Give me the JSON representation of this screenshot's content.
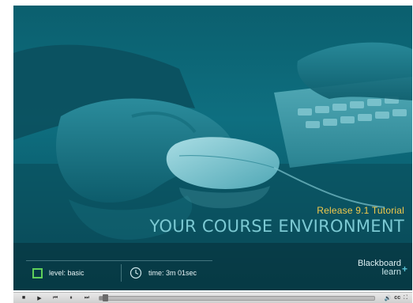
{
  "slide": {
    "subtitle": "Release 9.1 Tutorial",
    "title": "YOUR COURSE ENVIRONMENT"
  },
  "info": {
    "level": "level: basic",
    "time": "time: 3m 01sec"
  },
  "brand": {
    "line1": "Blackboard",
    "line2": "learn"
  },
  "controls": {
    "buttons": [
      "stop-icon",
      "play-icon",
      "skip-back-icon",
      "pause-icon",
      "skip-forward-icon"
    ],
    "progress": 0.02,
    "cc_label": "cc"
  },
  "colors": {
    "slide_base": "#0b5f6e",
    "title": "#7cc9d3",
    "subtitle": "#f2c94c",
    "level_icon": "#5fcf5a"
  }
}
